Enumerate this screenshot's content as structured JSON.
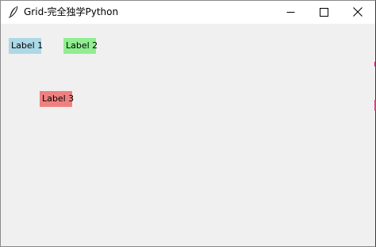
{
  "window": {
    "title": "Grid-完全独学Python",
    "app_icon": "feather-icon",
    "controls": {
      "minimize_icon": "minimize-icon",
      "maximize_icon": "maximize-icon",
      "close_icon": "close-icon"
    }
  },
  "labels": [
    {
      "text": "Label 1",
      "background": "#add8e6"
    },
    {
      "text": "Label 2",
      "background": "#90ee90"
    },
    {
      "text": "Label 3",
      "background": "#f08080"
    }
  ],
  "colors": {
    "titlebar": "#ffffff",
    "client_background": "#f0f0f0"
  }
}
